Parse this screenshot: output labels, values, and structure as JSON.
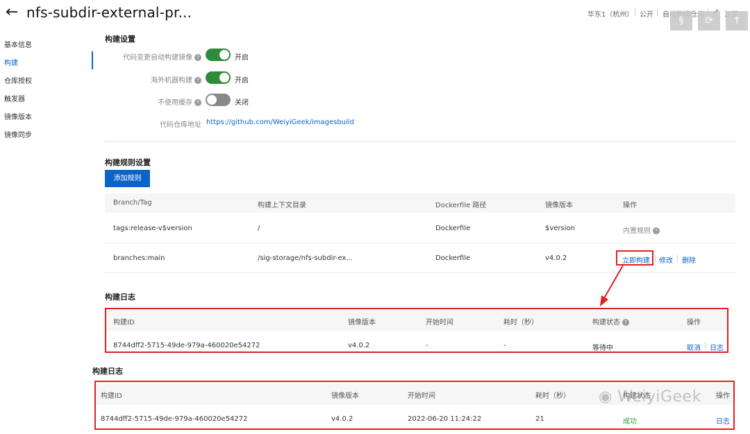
{
  "header": {
    "title": "nfs-subdir-external-pr...",
    "region": "华东1（杭州）",
    "visibility": "公开",
    "repo_type": "自动构建仓库",
    "status": "正常"
  },
  "sidebar": {
    "items": [
      {
        "label": "基本信息",
        "active": false
      },
      {
        "label": "构建",
        "active": true
      },
      {
        "label": "仓库授权",
        "active": false
      },
      {
        "label": "触发器",
        "active": false
      },
      {
        "label": "镜像版本",
        "active": false
      },
      {
        "label": "镜像同步",
        "active": false
      }
    ]
  },
  "build_settings": {
    "title": "构建设置",
    "auto_build": {
      "label": "代码变更自动构建镜像",
      "state": "开启",
      "on": true
    },
    "overseas": {
      "label": "海外机器构建",
      "state": "开启",
      "on": true
    },
    "no_cache": {
      "label": "不使用缓存",
      "state": "关闭",
      "on": false
    },
    "repo_address": {
      "label": "代码仓库地址",
      "value": "https://github.com/WeiyiGeek/imagesbuild"
    }
  },
  "rules": {
    "title": "构建规则设置",
    "add_button": "添加规则",
    "columns": [
      "Branch/Tag",
      "构建上下文目录",
      "Dockerfile 路径",
      "镜像版本",
      "操作"
    ],
    "rows": [
      {
        "branch": "tags:release-v$version",
        "context": "/",
        "dockerfile": "Dockerfile",
        "version": "$version",
        "builtin": "内置规则"
      },
      {
        "branch": "branches:main",
        "context": "/sig-storage/nfs-subdir-ex...",
        "dockerfile": "Dockerfile",
        "version": "v4.0.2",
        "build_now": "立即构建",
        "edit": "修改",
        "delete": "删除"
      }
    ]
  },
  "log1": {
    "title": "构建日志",
    "columns": [
      "构建ID",
      "镜像版本",
      "开始时间",
      "耗时（秒）",
      "构建状态",
      "操作"
    ],
    "row": {
      "id": "8744dff2-5715-49de-979a-460020e54272",
      "version": "v4.0.2",
      "start": "-",
      "duration": "-",
      "status": "等待中",
      "cancel": "取消",
      "log": "日志"
    }
  },
  "log2": {
    "title": "构建日志",
    "columns": [
      "构建ID",
      "镜像版本",
      "开始时间",
      "耗时（秒）",
      "构建状态",
      "操作"
    ],
    "row": {
      "id": "8744dff2-5715-49de-979a-460020e54272",
      "version": "v4.0.2",
      "start": "2022-06-20 11:24:22",
      "duration": "21",
      "status": "成功",
      "log": "日志"
    }
  },
  "watermark": "WeiyiGeek"
}
